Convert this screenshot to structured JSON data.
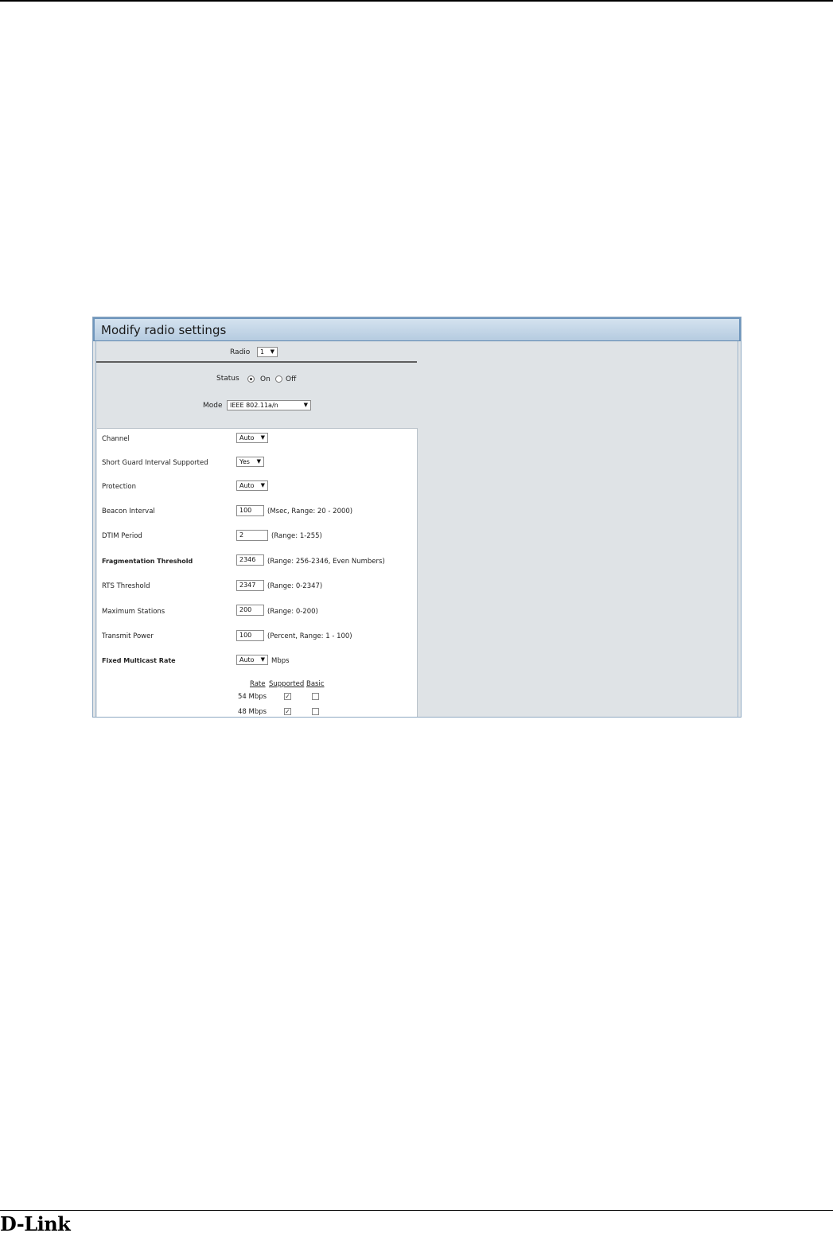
{
  "panel": {
    "title": "Modify radio settings",
    "radio": {
      "label": "Radio",
      "value": "1"
    },
    "status": {
      "label": "Status",
      "on_label": "On",
      "off_label": "Off",
      "selected": "On"
    },
    "mode": {
      "label": "Mode",
      "value": "IEEE 802.11a/n"
    }
  },
  "settings": {
    "channel": {
      "label": "Channel",
      "value": "Auto"
    },
    "sgi": {
      "label": "Short Guard Interval Supported",
      "value": "Yes"
    },
    "protection": {
      "label": "Protection",
      "value": "Auto"
    },
    "beacon": {
      "label": "Beacon Interval",
      "value": "100",
      "hint": "(Msec, Range: 20 - 2000)"
    },
    "dtim": {
      "label": "DTIM Period",
      "value": "2",
      "hint": "(Range: 1-255)"
    },
    "frag": {
      "label": "Fragmentation Threshold",
      "value": "2346",
      "hint": "(Range: 256-2346, Even Numbers)"
    },
    "rts": {
      "label": "RTS Threshold",
      "value": "2347",
      "hint": "(Range: 0-2347)"
    },
    "maxsta": {
      "label": "Maximum Stations",
      "value": "200",
      "hint": "(Range: 0-200)"
    },
    "txpower": {
      "label": "Transmit Power",
      "value": "100",
      "hint": "(Percent, Range: 1 - 100)"
    },
    "multicast": {
      "label": "Fixed Multicast Rate",
      "value": "Auto",
      "unit": "Mbps"
    }
  },
  "rate_table": {
    "headers": {
      "rate": "Rate",
      "supported": "Supported",
      "basic": "Basic"
    },
    "rows": [
      {
        "rate": "54 Mbps",
        "supported": true,
        "basic": false
      },
      {
        "rate": "48 Mbps",
        "supported": true,
        "basic": false
      }
    ]
  },
  "footer": {
    "logo": "D-Link"
  }
}
